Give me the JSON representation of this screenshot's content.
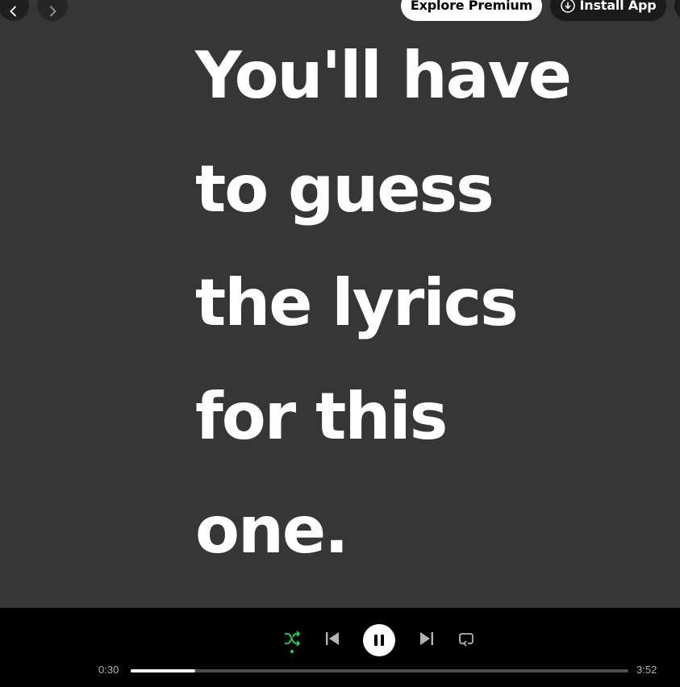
{
  "topbar": {
    "back_icon": "chevron-left-icon",
    "forward_icon": "chevron-right-icon",
    "premium_label": "Explore Premium",
    "install_label": "Install App",
    "install_icon": "download-circle-icon"
  },
  "lyrics": {
    "lines": [
      "You'll have",
      "to guess",
      "the lyrics",
      "for this",
      "one."
    ]
  },
  "player": {
    "shuffle_icon": "shuffle-icon",
    "shuffle_active": true,
    "previous_icon": "skip-previous-icon",
    "play_icon": "pause-icon",
    "next_icon": "skip-next-icon",
    "repeat_icon": "repeat-icon",
    "current_time": "0:30",
    "total_time": "3:52",
    "progress": 0.129
  },
  "colors": {
    "background": "#363636",
    "player_bg": "#000000",
    "accent": "#1ed760",
    "text": "#ffffff"
  }
}
